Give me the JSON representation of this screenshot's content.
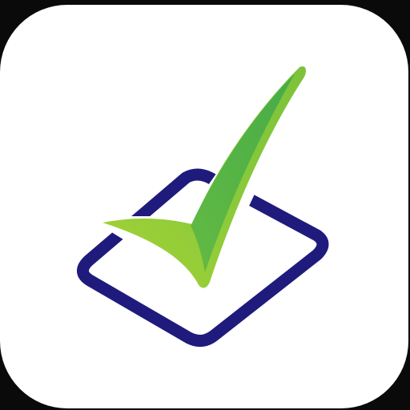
{
  "app_icon": {
    "name": "checklist-app-icon",
    "colors": {
      "background": "#0a0a0a",
      "card": "#ffffff",
      "box_outline": "#1f1b7c",
      "check_light": "#a6d236",
      "check_mid": "#7cc23a",
      "check_dark": "#3fa94a"
    }
  }
}
